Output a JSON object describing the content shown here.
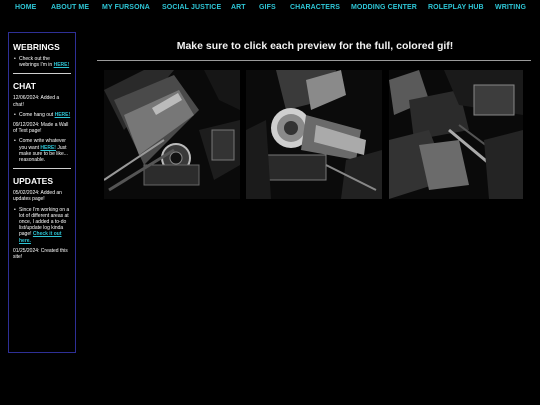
{
  "nav": {
    "items": [
      {
        "label": "HOME"
      },
      {
        "label": "ABOUT ME"
      },
      {
        "label": "MY FURSONA"
      },
      {
        "label": "SOCIAL JUSTICE"
      },
      {
        "label": "ART"
      },
      {
        "label": "GIFS"
      },
      {
        "label": "CHARACTERS"
      },
      {
        "label": "MODDING CENTER"
      },
      {
        "label": "ROLEPLAY HUB"
      },
      {
        "label": "WRITING"
      }
    ]
  },
  "sidebar": {
    "webrings": {
      "heading": "WEBRINGS",
      "text": "Check out the webrings I'm in",
      "link": "HERE!"
    },
    "chat": {
      "heading": "CHAT",
      "entry1": "12/06/2024: Added a chat!",
      "bullet1_text": "Come hang out",
      "bullet1_link": "HERE!",
      "entry2": "09/12/2024: Made a Wall of Text page!",
      "bullet2_text": "Come write whatever you want",
      "bullet2_link": "HERE!",
      "bullet2_tail": "Just make sure to be like... reasonable."
    },
    "updates": {
      "heading": "UPDATES",
      "entry1": "05/02/2024: Added an updates page!",
      "bullet_text": "Since I'm working on a lot of different areas at once, I added a to-do list/update log kinda page!",
      "bullet_link": "Check it out here.",
      "entry2": "01/25/2024: Created this site!"
    }
  },
  "main": {
    "title": "Make sure to click each preview for the full, colored gif!"
  },
  "colors": {
    "accent": "#2ec6d6",
    "sidebar_border": "#2e2f96",
    "background": "#000000"
  }
}
